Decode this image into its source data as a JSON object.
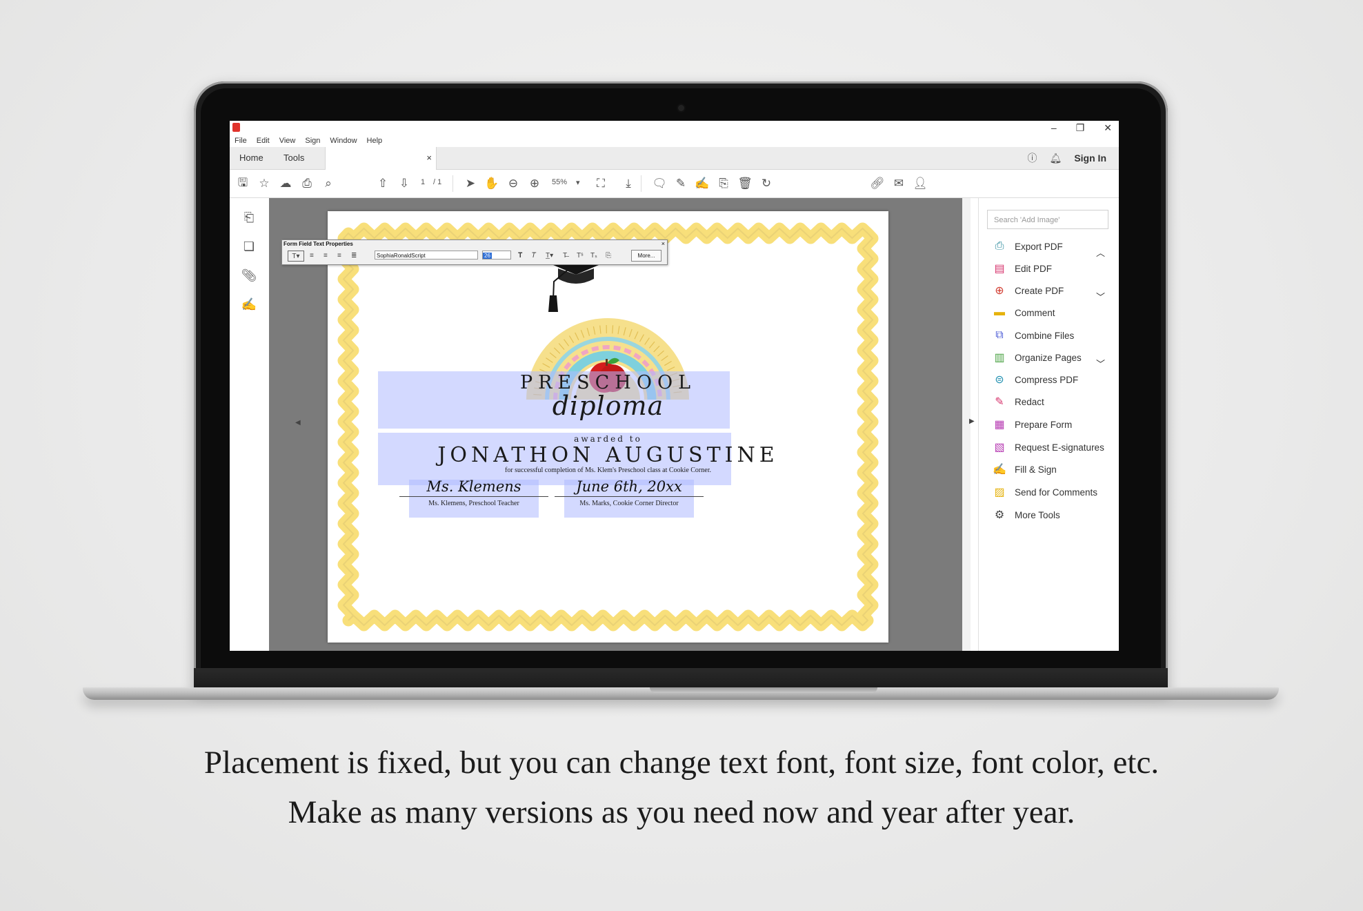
{
  "app": {
    "menu": [
      "File",
      "Edit",
      "View",
      "Sign",
      "Window",
      "Help"
    ],
    "tabs": {
      "home": "Home",
      "tools": "Tools",
      "close": "×"
    },
    "sign_in": "Sign In",
    "toolbar": {
      "page_current": "1",
      "page_total": "/ 1",
      "zoom": "55%"
    },
    "right_panel": {
      "search_placeholder": "Search 'Add Image'",
      "tools": [
        {
          "label": "Export PDF",
          "icon": "export-pdf-icon",
          "color": "#2b8a9c"
        },
        {
          "label": "Edit PDF",
          "icon": "edit-pdf-icon",
          "color": "#d6336c"
        },
        {
          "label": "Create PDF",
          "icon": "create-pdf-icon",
          "color": "#d13b2f"
        },
        {
          "label": "Comment",
          "icon": "comment-icon",
          "color": "#e5b20c"
        },
        {
          "label": "Combine Files",
          "icon": "combine-files-icon",
          "color": "#4b5bd6"
        },
        {
          "label": "Organize Pages",
          "icon": "organize-pages-icon",
          "color": "#4aa243"
        },
        {
          "label": "Compress PDF",
          "icon": "compress-pdf-icon",
          "color": "#1f8fb0"
        },
        {
          "label": "Redact",
          "icon": "redact-icon",
          "color": "#d6336c"
        },
        {
          "label": "Prepare Form",
          "icon": "prepare-form-icon",
          "color": "#b63ab2"
        },
        {
          "label": "Request E-signatures",
          "icon": "request-esignatures-icon",
          "color": "#b63ab2"
        },
        {
          "label": "Fill & Sign",
          "icon": "fill-sign-icon",
          "color": "#7a4fd1"
        },
        {
          "label": "Send for Comments",
          "icon": "send-comments-icon",
          "color": "#e5b20c"
        },
        {
          "label": "More Tools",
          "icon": "more-tools-icon",
          "color": "#444444"
        }
      ]
    }
  },
  "props": {
    "title": "Form Field Text Properties",
    "close": "×",
    "font": "SophiaRonaldScript",
    "size": "26",
    "more": "More..."
  },
  "certificate": {
    "title": "PRESCHOOL",
    "subtitle": "diploma",
    "awarded": "awarded to",
    "recipient": "JONATHON AUGUSTINE",
    "completion": "for successful completion of Ms. Klem's Preschool class at Cookie Corner.",
    "sig_left_name": "Ms. Klemens",
    "sig_left_role": "Ms. Klemens, Preschool Teacher",
    "sig_right_name": "June 6th, 20xx",
    "sig_right_role": "Ms. Marks, Cookie Corner Director"
  },
  "caption": {
    "line1": "Placement is fixed, but you can change text font, font size, font color, etc.",
    "line2": "Make as many versions as you need now and year after year."
  },
  "colors": {
    "border_yellow": "#f8df7a",
    "field_blue": "#aeb8ff",
    "apple_red": "#d41d1d"
  }
}
